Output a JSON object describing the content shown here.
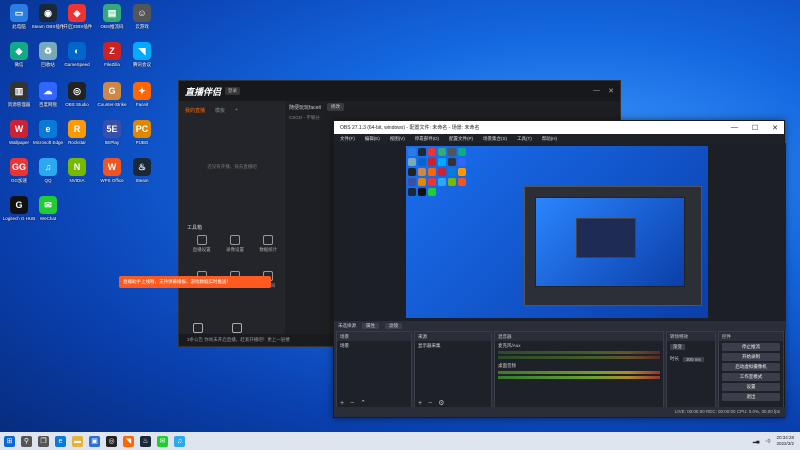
{
  "desktop": {
    "icons": [
      {
        "label": "此电脑",
        "color": "#2b7de1",
        "glyph": "▭"
      },
      {
        "label": "Steam OBS插件",
        "color": "#1b2838",
        "glyph": "◉"
      },
      {
        "label": "(开启)OBS插件",
        "color": "#e33",
        "glyph": "◈"
      },
      {
        "label": "OBS推流码",
        "color": "#3a7",
        "glyph": "▤"
      },
      {
        "label": "云游戏",
        "color": "#555",
        "glyph": "☺"
      },
      {
        "label": "微信",
        "color": "#1a8",
        "glyph": "◆"
      },
      {
        "label": "回收站",
        "color": "#7ab",
        "glyph": "♻"
      },
      {
        "label": "GameSpeed",
        "color": "#06c",
        "glyph": "◐"
      },
      {
        "label": "FileZilla",
        "color": "#c22",
        "glyph": "Z"
      },
      {
        "label": "腾讯会议",
        "color": "#0af",
        "glyph": "◥"
      },
      {
        "label": "资源管理器",
        "color": "#333",
        "glyph": "▥"
      },
      {
        "label": "百度网盘",
        "color": "#36f",
        "glyph": "☁"
      },
      {
        "label": "OBS Studio",
        "color": "#222",
        "glyph": "◎"
      },
      {
        "label": "Counter-Strike",
        "color": "#c84",
        "glyph": "G"
      },
      {
        "label": "Faceit",
        "color": "#f60",
        "glyph": "✦"
      },
      {
        "label": "Wallpaper",
        "color": "#c23",
        "glyph": "W"
      },
      {
        "label": "Microsoft Edge",
        "color": "#0a7ad8",
        "glyph": "e"
      },
      {
        "label": "Rockstar",
        "color": "#f90",
        "glyph": "R"
      },
      {
        "label": "5EPlay",
        "color": "#3a4fa8",
        "glyph": "5E"
      },
      {
        "label": "PUBG",
        "color": "#d80",
        "glyph": "PC"
      },
      {
        "label": "GG加速",
        "color": "#e33",
        "glyph": "GG"
      },
      {
        "label": "QQ",
        "color": "#2ba8f0",
        "glyph": "♫"
      },
      {
        "label": "NVIDIA",
        "color": "#76b900",
        "glyph": "N"
      },
      {
        "label": "WPS Office",
        "color": "#e52",
        "glyph": "W"
      },
      {
        "label": "Steam",
        "color": "#1b2838",
        "glyph": "♨"
      },
      {
        "label": "Logitech G HUB",
        "color": "#111",
        "glyph": "G"
      },
      {
        "label": "WeChat",
        "color": "#2c3",
        "glyph": "✉"
      }
    ]
  },
  "douyu": {
    "logo": "直播伴侣",
    "version": "登录",
    "tabs": [
      "我的直播",
      "模板",
      "+"
    ],
    "empty_hint": "还没有开播，快去直播吧",
    "room_title": "随便玩玩faceit",
    "room_btn": "修改",
    "category": "CSGO - 不够分",
    "tools_label": "工具箱",
    "tools": [
      "直播设置",
      "录像设置",
      "数据统计",
      "房管助手",
      "弹幕助手",
      "直播间"
    ],
    "orange_tip": "直播助手上线啦，支持弹幕播报、游戏数据实时推送！",
    "start_items": [
      "主播一起玩",
      "发送弹幕"
    ],
    "footer": "3条公告  你尚未开启直播，赶紧开播吧！更上一层楼"
  },
  "obs": {
    "title": "OBS 27.1.3 (64-bit, windows) - 配置文件: 未命名 - 场景: 未命名",
    "menu": [
      "文件(F)",
      "编辑(E)",
      "视图(V)",
      "停靠部件(D)",
      "配置文件(P)",
      "场景集合(S)",
      "工具(T)",
      "帮助(H)"
    ],
    "scene_label": "未选择源",
    "scene_btn1": "属性",
    "scene_btn2": "滤镜",
    "docks": {
      "scenes": {
        "header": "场景",
        "item": "场景"
      },
      "sources": {
        "header": "来源",
        "item": "显示器采集"
      },
      "mixer": {
        "header": "混音器",
        "ch1": "麦克风/Aux",
        "ch2": "桌面音频"
      },
      "transitions": {
        "header": "转场特效",
        "type": "渐变",
        "duration_label": "时长",
        "duration": "300 ms"
      },
      "controls": {
        "header": "控件",
        "buttons": [
          "停止推流",
          "开始录制",
          "启动虚拟摄像机",
          "工作室模式",
          "设置",
          "退出"
        ]
      }
    },
    "status": "LIVE: 00:00:00   REC: 00:00:00   CPU: 0.0%, 30.00 fps"
  },
  "taskbar": {
    "icons": [
      {
        "name": "windows-start-icon",
        "color": "#0a67d8",
        "glyph": "⊞"
      },
      {
        "name": "search-icon",
        "color": "#555",
        "glyph": "⚲"
      },
      {
        "name": "task-view-icon",
        "color": "#555",
        "glyph": "❐"
      },
      {
        "name": "edge-icon",
        "color": "#0a7ad8",
        "glyph": "e"
      },
      {
        "name": "explorer-icon",
        "color": "#e8b13a",
        "glyph": "▬"
      },
      {
        "name": "store-icon",
        "color": "#2a6fd6",
        "glyph": "▣"
      },
      {
        "name": "obs-icon",
        "color": "#222",
        "glyph": "◎"
      },
      {
        "name": "douyu-icon",
        "color": "#f60",
        "glyph": "◥"
      },
      {
        "name": "steam-icon",
        "color": "#1b2838",
        "glyph": "♨"
      },
      {
        "name": "wechat-icon",
        "color": "#2c3",
        "glyph": "✉"
      },
      {
        "name": "qq-icon",
        "color": "#2ba8f0",
        "glyph": "♫"
      }
    ],
    "time": "20:34:28",
    "date": "2022/3/2"
  }
}
